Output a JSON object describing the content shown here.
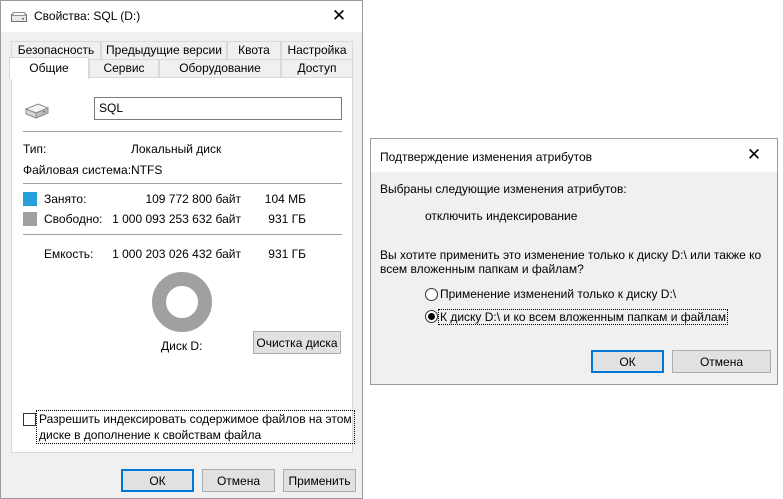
{
  "properties": {
    "title": "Свойства: SQL (D:)",
    "tabs_row1": [
      "Безопасность",
      "Предыдущие версии",
      "Квота",
      "Настройка"
    ],
    "tabs_row2": [
      "Общие",
      "Сервис",
      "Оборудование",
      "Доступ"
    ],
    "active_tab": "Общие",
    "drive_name": "SQL",
    "type_label": "Тип:",
    "type_value": "Локальный диск",
    "fs_label": "Файловая система:",
    "fs_value": "NTFS",
    "used_label": "Занято:",
    "used_bytes": "109 772 800 байт",
    "used_short": "104 МБ",
    "free_label": "Свободно:",
    "free_bytes": "1 000 093 253 632 байт",
    "free_short": "931 ГБ",
    "capacity_label": "Емкость:",
    "capacity_bytes": "1 000 203 026 432 байт",
    "capacity_short": "931 ГБ",
    "disk_label": "Диск D:",
    "cleanup_button": "Очистка диска",
    "index_line1": "Разрешить индексировать содержимое файлов на этом",
    "index_line2": "диске в дополнение к свойствам файла",
    "index_checked": false,
    "ok_button": "ОК",
    "cancel_button": "Отмена",
    "apply_button": "Применить",
    "used_fraction": 0.0001,
    "colors": {
      "used": "#26a0da",
      "free": "#a0a0a0"
    }
  },
  "dialog": {
    "title": "Подтверждение изменения атрибутов",
    "intro": "Выбраны следующие изменения атрибутов:",
    "change": "отключить индексирование",
    "question_line1": "Вы хотите применить это изменение только к диску D:\\ или также ко",
    "question_line2": "всем вложенным папкам и файлам?",
    "option1": "Применение изменений только к диску D:\\",
    "option2": "К диску D:\\ и ко всем вложенным папкам и файлам",
    "selected_option": 2,
    "ok_button": "ОК",
    "cancel_button": "Отмена"
  }
}
